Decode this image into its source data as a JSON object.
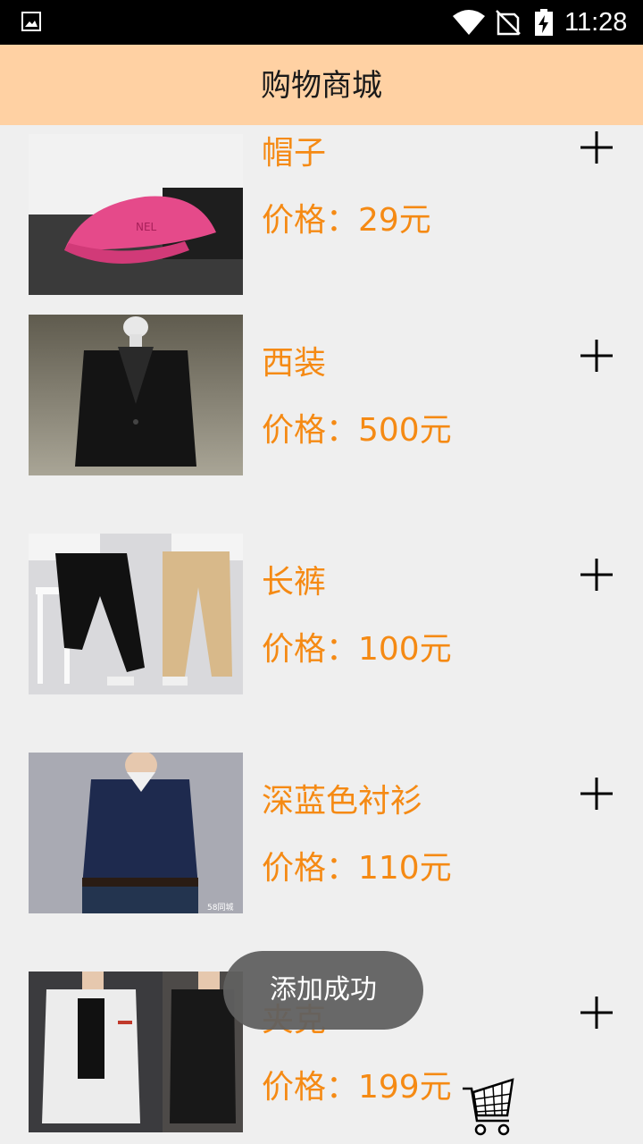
{
  "status_bar": {
    "time": "11:28",
    "icons": [
      "image-icon",
      "wifi-icon",
      "signal-icon",
      "battery-charging-icon"
    ]
  },
  "app_bar": {
    "title": "购物商城"
  },
  "products": [
    {
      "name": "帽子",
      "price": "价格：29元",
      "image": "pink-cap"
    },
    {
      "name": "西装",
      "price": "价格：500元",
      "image": "black-suit"
    },
    {
      "name": "长裤",
      "price": "价格：100元",
      "image": "pants"
    },
    {
      "name": "深蓝色衬衫",
      "price": "价格：110元",
      "image": "navy-polo-shirt"
    },
    {
      "name": "夹克",
      "price": "价格：199元",
      "image": "jackets"
    }
  ],
  "toast": {
    "message": "添加成功"
  },
  "colors": {
    "app_bar": "#ffd1a3",
    "accent": "#f58a14",
    "background": "#efefef"
  }
}
